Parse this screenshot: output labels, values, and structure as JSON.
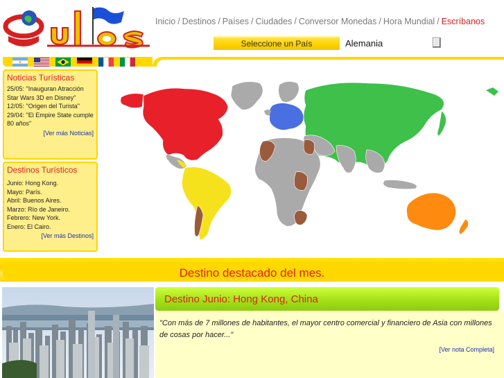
{
  "site": {
    "logo_text": "Gulas"
  },
  "nav": {
    "items": [
      {
        "label": "Inicio"
      },
      {
        "label": "Destinos"
      },
      {
        "label": "Países"
      },
      {
        "label": "Ciudades"
      },
      {
        "label": "Conversor Monedas"
      },
      {
        "label": "Hora Mundial"
      }
    ],
    "contact_label": "Escríbanos"
  },
  "country_select": {
    "label": "Seleccione un País",
    "value": "Alemania"
  },
  "flags": [
    "argentina",
    "usa",
    "brazil",
    "germany",
    "france",
    "italy"
  ],
  "news": {
    "title": "Noticias Turísticas",
    "items": [
      "25/05: \"Inauguran Atracción Star Wars 3D en Disney\"",
      "12/05: \"Origen del Turista\"",
      "29/04: \"El Empire State cumple 80 años\""
    ],
    "more_label": "[Ver más Noticias]"
  },
  "destinations": {
    "title": "Destinos Turísticos",
    "items": [
      "Junio: Hong Kong.",
      "Mayo: París.",
      "Abril: Buenos Aires.",
      "Marzo: Río de Janeiro.",
      "Febrero: New York.",
      "Enero: El Cairo."
    ],
    "more_label": "[Ver más Destinos]"
  },
  "map": {
    "colors": {
      "north_america": "#e8202a",
      "south_america": "#f6e21c",
      "europe": "#4a6fe0",
      "russia_asia": "#3ec04a",
      "africa_highlight": "#9a5a3c",
      "australia": "#ff8a10",
      "other": "#aaaaaa"
    }
  },
  "highlight": {
    "title": "Destino destacado del mes."
  },
  "featured": {
    "heading": "Destino Junio: Hong Kong, China",
    "quote": "\"Con más de 7 millones de habitantes, el mayor centro comercial y financiero de Asia con millones de cosas por hacer...\"",
    "more_label": "[Ver nota Completa]"
  }
}
